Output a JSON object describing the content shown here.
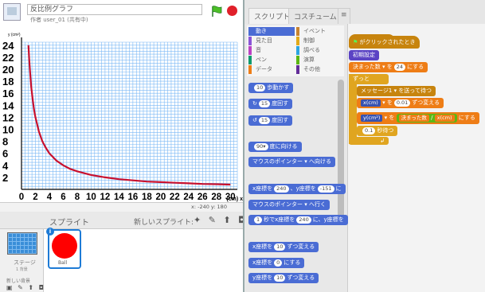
{
  "project": {
    "title": "反比例グラフ",
    "author": "作者 user_01 (共有中)",
    "icon_label": "SB2"
  },
  "controls": {
    "flag_icon": "green-flag-icon",
    "stop_icon": "stop-icon"
  },
  "chart_data": {
    "type": "line",
    "title": "",
    "xlabel": "(cm) x",
    "ylabel": "y (cm²)",
    "x_ticks": [
      "0",
      "2",
      "4",
      "6",
      "8",
      "10",
      "12",
      "14",
      "16",
      "18",
      "20",
      "22",
      "24",
      "26",
      "28",
      "30"
    ],
    "y_ticks": [
      "24",
      "22",
      "20",
      "18",
      "16",
      "14",
      "12",
      "10",
      "8",
      "6",
      "4",
      "2"
    ],
    "xlim": [
      0,
      31
    ],
    "ylim": [
      0,
      24.5
    ],
    "grid": true,
    "line_color": "#c8102e",
    "grid_color": "#7ab8f5",
    "series": [
      {
        "x": [
          1.0,
          1.1,
          1.2,
          1.4,
          1.6,
          1.8,
          2.0,
          2.5,
          3.0,
          3.5,
          4.0,
          5.0,
          6.0,
          7.0,
          8.0,
          10.0,
          12.0,
          14.0,
          16.0,
          18.0,
          20.0,
          22.0,
          24.0,
          26.0,
          28.0,
          30.0
        ],
        "y": [
          24.0,
          21.8,
          20.0,
          17.1,
          15.0,
          13.3,
          12.0,
          9.6,
          8.0,
          6.9,
          6.0,
          4.8,
          4.0,
          3.4,
          3.0,
          2.4,
          2.0,
          1.7,
          1.5,
          1.3,
          1.2,
          1.1,
          1.0,
          0.9,
          0.86,
          0.8
        ]
      }
    ]
  },
  "stage_footer": {
    "coords": "x: -240  y: 180"
  },
  "sprite_pane": {
    "title": "スプライト",
    "new_sprite": "新しいスプライト:",
    "tools": "✦ ✎ ⬆ ◘",
    "stage_label": "ステージ",
    "stage_sub": "1 背景",
    "new_backdrop": "新しい背景",
    "backdrop_tools": "▣ ✎ ⬆ ◘",
    "sprite_name": "Ball",
    "info": "i",
    "ball_color": "#ff0000"
  },
  "tabs": {
    "script": "スクリプト",
    "costume": "コスチューム",
    "sound": "≡"
  },
  "categories": [
    {
      "label": "動き",
      "color": "#4a6cd4",
      "selected": true
    },
    {
      "label": "イベント",
      "color": "#c88330"
    },
    {
      "label": "見た目",
      "color": "#8a55d7"
    },
    {
      "label": "制御",
      "color": "#e1a91a"
    },
    {
      "label": "音",
      "color": "#bb42c3"
    },
    {
      "label": "調べる",
      "color": "#2ca5e2"
    },
    {
      "label": "ペン",
      "color": "#0e9a6c"
    },
    {
      "label": "演算",
      "color": "#5cb712"
    },
    {
      "label": "データ",
      "color": "#ee7d16"
    },
    {
      "label": "その他",
      "color": "#632d99"
    }
  ],
  "palette_blocks": {
    "move": {
      "num": "10",
      "text": "歩動かす"
    },
    "turn_right": {
      "icon": "↻",
      "num": "15",
      "text": "度回す"
    },
    "turn_left": {
      "icon": "↺",
      "num": "15",
      "text": "度回す"
    },
    "point_dir": {
      "num": "90▾",
      "text": "度に向ける"
    },
    "point_towards": {
      "text": "マウスのポインター",
      "arrow": "▾",
      "suffix": "へ向ける"
    },
    "goto_xy": {
      "t1": "x座標を",
      "n1": "240",
      "t2": "、y座標を",
      "n2": "-151",
      "t3": "に"
    },
    "goto": {
      "text": "マウスのポインター",
      "arrow": "▾",
      "suffix": "へ行く"
    },
    "glide": {
      "n1": "1",
      "t1": "秒でx座標を",
      "n2": "240",
      "t2": "に、y座標を"
    },
    "change_x": {
      "t1": "x座標を",
      "n": "10",
      "t2": "ずつ変える"
    },
    "set_x": {
      "t1": "x座標を",
      "n": "0",
      "t2": "にする"
    },
    "change_y": {
      "t1": "y座標を",
      "n": "10",
      "t2": "ずつ変える"
    }
  },
  "script": {
    "hat": "がクリックされたとき",
    "init": "初期設定",
    "set_var": {
      "var": "決まった数",
      "arrow": "▾",
      "t1": "を",
      "n": "24",
      "t2": "にする"
    },
    "forever": "ずっと",
    "broadcast": {
      "text": "メッセージ1",
      "arrow": "▾",
      "t2": "を送って待つ"
    },
    "change_xcm": {
      "var": "x(cm)",
      "arrow": "▾",
      "t1": "を",
      "n": "0.01",
      "t2": "ずつ変える"
    },
    "set_ycm": {
      "var": "y(cm²)",
      "arrow": "▾",
      "t1": "を",
      "r1": "決まった数",
      "op": "/",
      "r2": "x(cm)",
      "t2": "にする"
    },
    "wait": {
      "n": "0.1",
      "t": "秒待つ"
    },
    "loop_arrow": "↲"
  }
}
